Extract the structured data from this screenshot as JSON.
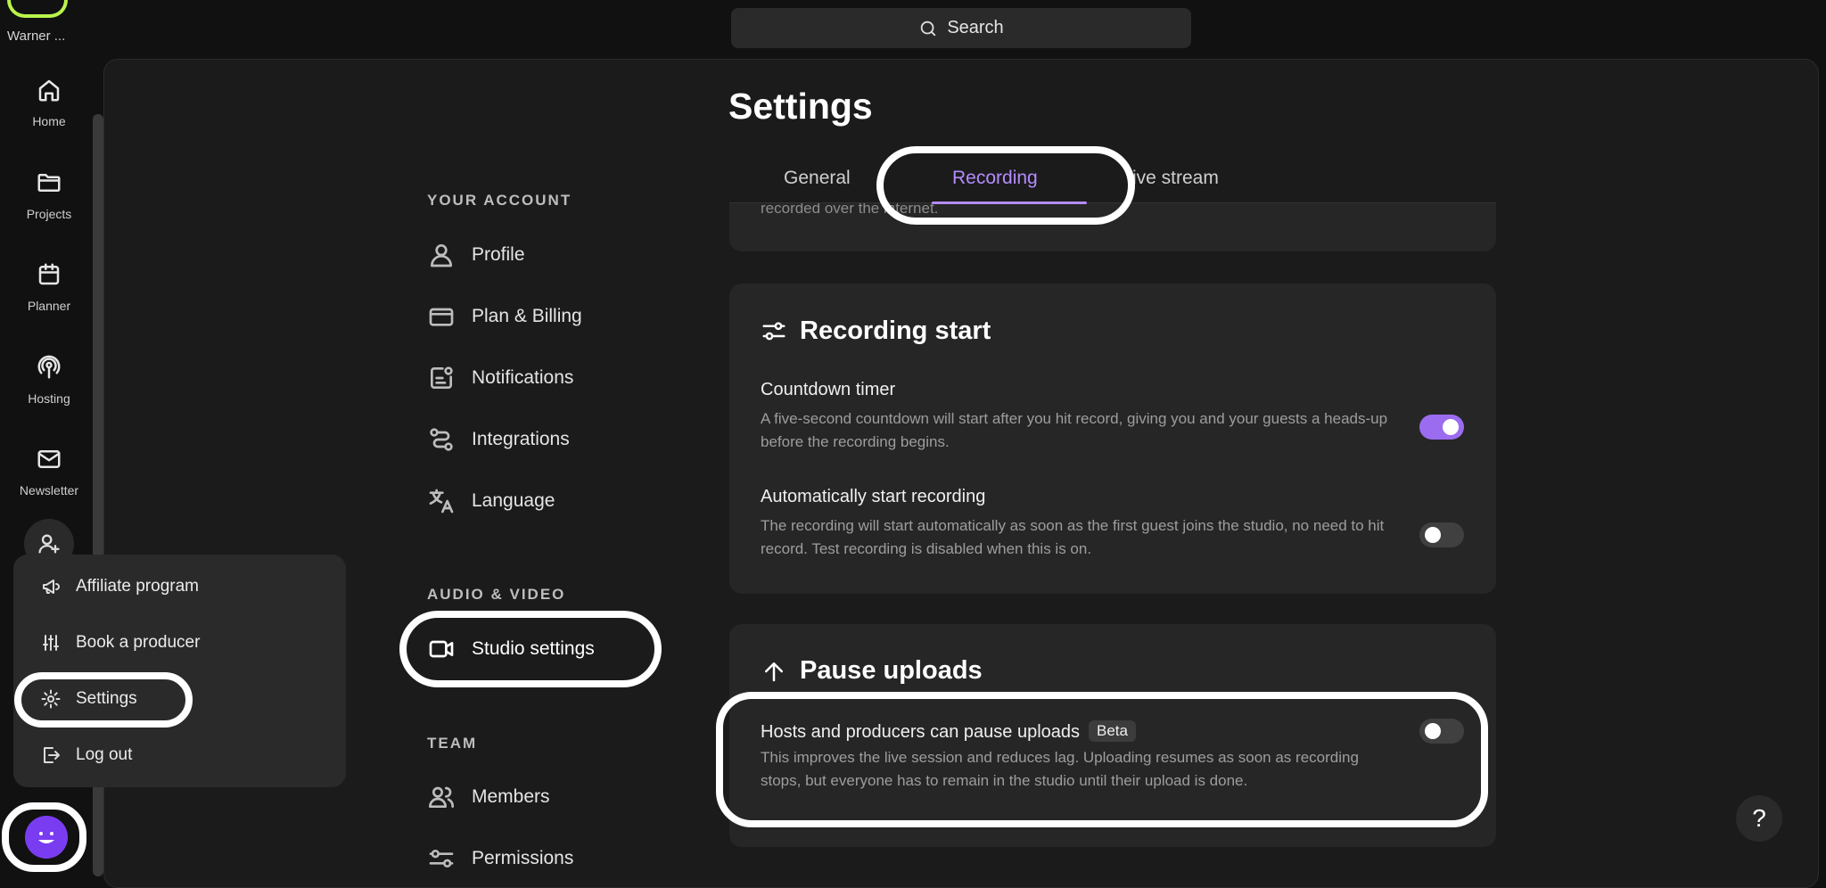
{
  "rail": {
    "brand": "Warner ...",
    "items": [
      {
        "label": "Home",
        "icon": "home-icon"
      },
      {
        "label": "Projects",
        "icon": "folder-icon"
      },
      {
        "label": "Planner",
        "icon": "calendar-icon"
      },
      {
        "label": "Hosting",
        "icon": "podcast-icon"
      },
      {
        "label": "Newsletter",
        "icon": "mail-icon"
      }
    ]
  },
  "search": {
    "label": "Search"
  },
  "page": {
    "title": "Settings"
  },
  "settings_nav": {
    "your_account": "YOUR ACCOUNT",
    "profile": "Profile",
    "plan_billing": "Plan & Billing",
    "notifications": "Notifications",
    "integrations": "Integrations",
    "language": "Language",
    "audio_video": "AUDIO & VIDEO",
    "studio_settings": "Studio settings",
    "team": "TEAM",
    "members": "Members",
    "permissions": "Permissions"
  },
  "tabs": {
    "general": "General",
    "recording": "Recording",
    "live_stream": "ive stream"
  },
  "top_card": {
    "partial_text": "recorded over the internet."
  },
  "recording_start": {
    "title": "Recording start",
    "countdown_title": "Countdown timer",
    "countdown_desc": "A five-second countdown will start after you hit record, giving you and your guests a heads-up before the recording begins.",
    "auto_title": "Automatically start recording",
    "auto_desc": "The recording will start automatically as soon as the first guest joins the studio, no need to hit record. Test recording is disabled when this is on."
  },
  "pause_uploads": {
    "title": "Pause uploads",
    "row_title": "Hosts and producers can pause uploads",
    "badge": "Beta",
    "row_desc": "This improves the live session and reduces lag. Uploading resumes as soon as recording stops, but everyone has to remain in the studio until their upload is done."
  },
  "menu": {
    "affiliate": "Affiliate program",
    "book_producer": "Book a producer",
    "settings": "Settings",
    "log_out": "Log out"
  },
  "help": {
    "label": "?"
  },
  "colors": {
    "accent": "#9b6cf0",
    "tab_active": "#b48cff",
    "brand": "#b9f34b"
  }
}
